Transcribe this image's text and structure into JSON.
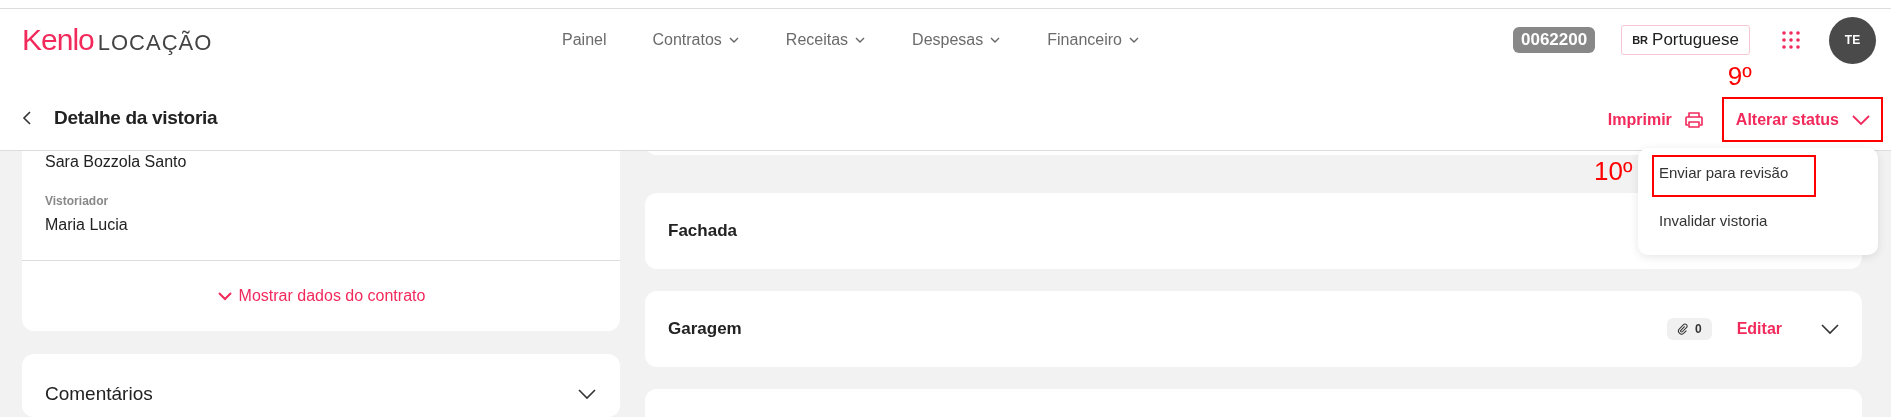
{
  "nav": {
    "logo": {
      "brand": "Kenlo",
      "product": "LOCAÇÃO"
    },
    "items": [
      {
        "label": "Painel",
        "has_menu": false
      },
      {
        "label": "Contratos",
        "has_menu": true
      },
      {
        "label": "Receitas",
        "has_menu": true
      },
      {
        "label": "Despesas",
        "has_menu": true
      },
      {
        "label": "Financeiro",
        "has_menu": true
      }
    ],
    "account_code": "0062200",
    "language": {
      "flag": "BR",
      "label": "Portuguese"
    },
    "avatar": "TE"
  },
  "header": {
    "title": "Detalhe da vistoria",
    "print_button": "Imprimir",
    "status_button": {
      "label": "Alterar status",
      "annotation": "9º"
    },
    "status_menu": {
      "expanded": true,
      "items": [
        {
          "label": "Enviar para revisão",
          "annotation": "10º"
        },
        {
          "label": "Invalidar vistoria"
        }
      ]
    }
  },
  "details_card": {
    "fields": [
      {
        "value": "Sara Bozzola Santo"
      },
      {
        "label": "Vistoriador",
        "value": "Maria Lucia"
      }
    ],
    "toggle": "Mostrar dados do contrato"
  },
  "comments_card": {
    "title": "Comentários",
    "expanded": false
  },
  "rooms": [
    {
      "name": "Fachada"
    },
    {
      "name": "Garagem",
      "attachments": "0",
      "edit": "Editar",
      "expanded": false
    }
  ]
}
